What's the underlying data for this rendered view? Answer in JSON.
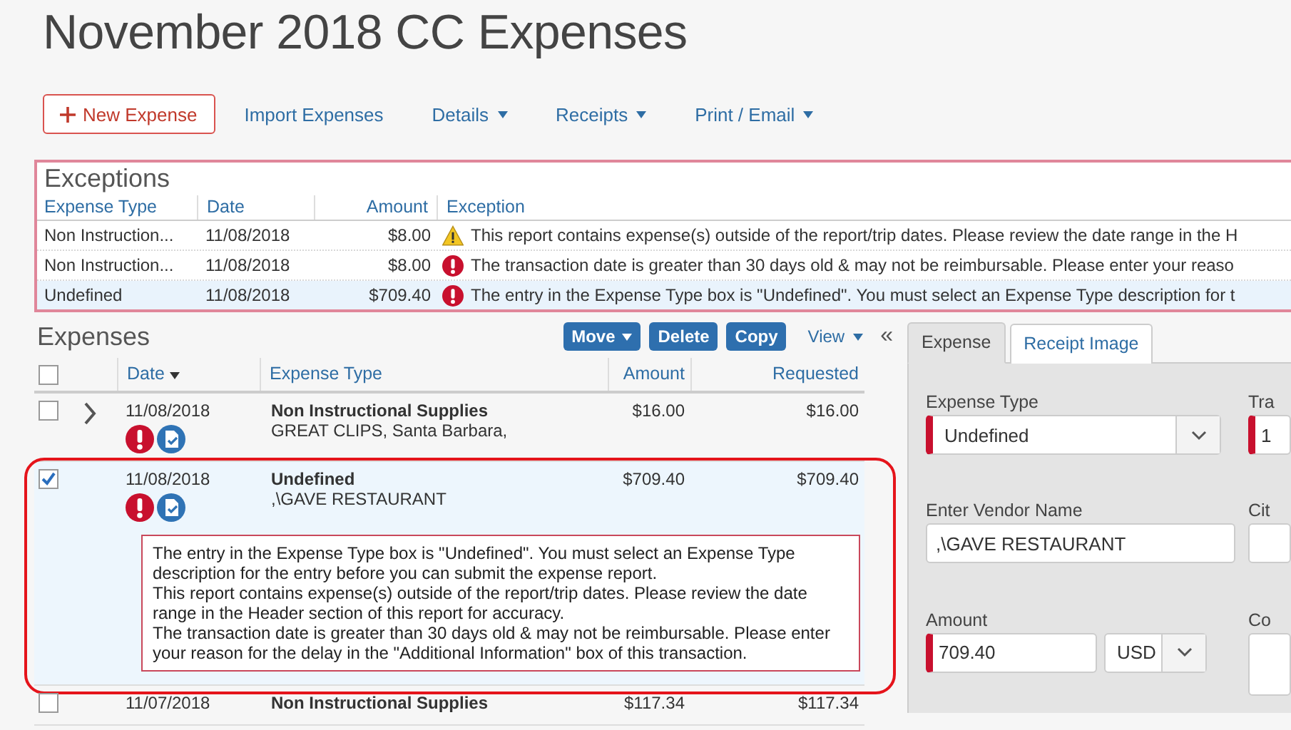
{
  "title": "November 2018 CC Expenses",
  "toolbar": [
    {
      "label": "New Expense",
      "kind": "add"
    },
    {
      "label": "Import Expenses",
      "kind": "link"
    },
    {
      "label": "Details",
      "kind": "menu"
    },
    {
      "label": "Receipts",
      "kind": "menu"
    },
    {
      "label": "Print / Email",
      "kind": "menu"
    }
  ],
  "exceptions": {
    "title": "Exceptions",
    "columns": [
      "Expense Type",
      "Date",
      "Amount",
      "Exception"
    ],
    "rows": [
      {
        "expense_type": "Non Instruction...",
        "date": "11/08/2018",
        "amount": "$8.00",
        "kind": "warning",
        "exception": "This report contains expense(s) outside of the report/trip dates. Please review the date range in the H",
        "selected": false
      },
      {
        "expense_type": "Non Instruction...",
        "date": "11/08/2018",
        "amount": "$8.00",
        "kind": "error",
        "exception": "The transaction date is greater than 30 days old & may not be reimbursable. Please enter your reaso",
        "selected": false
      },
      {
        "expense_type": "Undefined",
        "date": "11/08/2018",
        "amount": "$709.40",
        "kind": "error",
        "exception": "The entry in the Expense Type box is \"Undefined\". You must select an Expense Type description for t",
        "selected": true
      }
    ]
  },
  "expenses": {
    "title": "Expenses",
    "actions": [
      {
        "label": "Move",
        "kind": "menu"
      },
      {
        "label": "Delete",
        "kind": "button"
      },
      {
        "label": "Copy",
        "kind": "button"
      }
    ],
    "view": "View",
    "collapse": "«",
    "all_checked": false,
    "columns": [
      {
        "label": "Date",
        "sorted": true
      },
      {
        "label": "Expense Type",
        "sorted": false
      },
      {
        "label": "Amount",
        "sorted": false
      },
      {
        "label": "Requested",
        "sorted": false
      }
    ],
    "rows": [
      {
        "checked": false,
        "expandable": true,
        "selected": false,
        "date": "11/08/2018",
        "type": "Non Instructional Supplies",
        "vendor": "GREAT CLIPS, Santa Barbara,",
        "amount": "$16.00",
        "requested": "$16.00",
        "has_exception": true,
        "has_receipt": true,
        "messages": []
      },
      {
        "checked": true,
        "expandable": false,
        "selected": true,
        "date": "11/08/2018",
        "type": "Undefined",
        "vendor": ",\\GAVE RESTAURANT",
        "amount": "$709.40",
        "requested": "$709.40",
        "has_exception": true,
        "has_receipt": true,
        "messages": [
          "The entry in the Expense Type box is \"Undefined\". You must select an Expense Type description for the entry before you can submit the expense report.",
          "This report contains expense(s) outside of the report/trip dates. Please review the date range in the Header section of this report for accuracy.",
          "The transaction date is greater than 30 days old & may not be reimbursable. Please enter your reason for the delay in the \"Additional Information\" box of this transaction."
        ]
      },
      {
        "checked": false,
        "expandable": false,
        "selected": false,
        "date": "11/07/2018",
        "type": "Non Instructional Supplies",
        "amount": "$117.34",
        "requested": "$117.34",
        "has_exception": false,
        "has_receipt": false,
        "messages": []
      }
    ]
  },
  "detail": {
    "tabs": [
      {
        "label": "Expense",
        "selected": true
      },
      {
        "label": "Receipt Image",
        "selected": false
      }
    ],
    "fields": [
      {
        "label": "Expense Type",
        "kind": "select",
        "value": "Undefined",
        "required": true
      },
      {
        "label": "Tra",
        "kind": "input",
        "value": "1",
        "required": true
      },
      {
        "label": "Enter Vendor Name",
        "kind": "input",
        "value": ",\\GAVE RESTAURANT",
        "required": false
      },
      {
        "label": "Cit",
        "kind": "input",
        "required": false
      },
      {
        "label": "Amount",
        "kind": "amount",
        "value": "709.40",
        "currency": "USD",
        "required": true
      },
      {
        "label": "Co",
        "kind": "textarea",
        "required": false
      }
    ]
  }
}
